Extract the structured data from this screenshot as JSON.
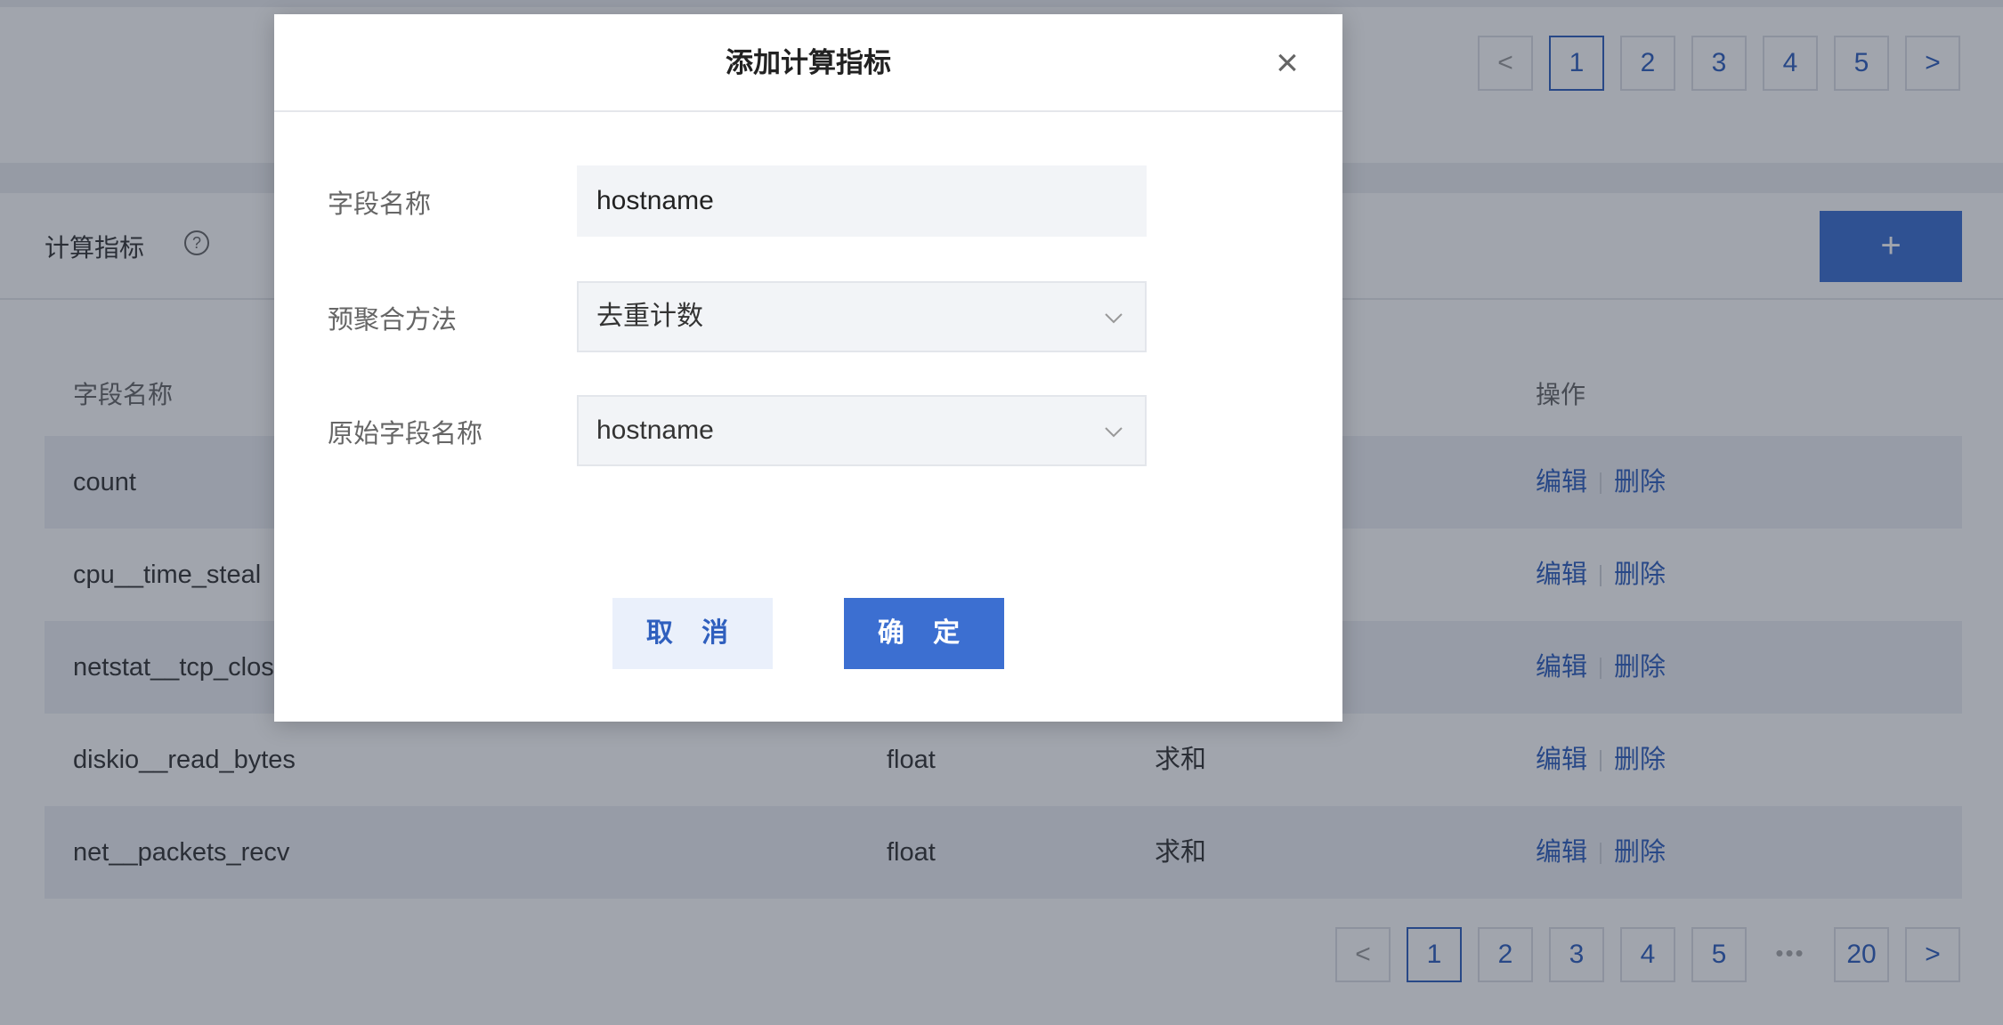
{
  "top_pagination": {
    "prev": "<",
    "pages": [
      "1",
      "2",
      "3",
      "4",
      "5"
    ],
    "next": ">",
    "active": "1"
  },
  "metrics": {
    "title": "计算指标",
    "help": "?",
    "add_button": "+",
    "columns": {
      "field_name": "字段名称",
      "operation": "操作"
    },
    "rows": [
      {
        "name": "count",
        "type": "",
        "method": ""
      },
      {
        "name": "cpu__time_steal",
        "type": "",
        "method": ""
      },
      {
        "name": "netstat__tcp_clos",
        "type": "",
        "method": ""
      },
      {
        "name": "diskio__read_bytes",
        "type": "float",
        "method": "求和"
      },
      {
        "name": "net__packets_recv",
        "type": "float",
        "method": "求和"
      }
    ],
    "edit_label": "编辑",
    "delete_label": "删除"
  },
  "bottom_pagination": {
    "prev": "<",
    "pages": [
      "1",
      "2",
      "3",
      "4",
      "5"
    ],
    "ellipsis": "•••",
    "last": "20",
    "next": ">",
    "active": "1"
  },
  "modal": {
    "title": "添加计算指标",
    "close": "×",
    "fields": {
      "field_name_label": "字段名称",
      "field_name_value": "hostname",
      "agg_method_label": "预聚合方法",
      "agg_method_value": "去重计数",
      "source_field_label": "原始字段名称",
      "source_field_value": "hostname"
    },
    "cancel": "取 消",
    "confirm": "确 定"
  }
}
